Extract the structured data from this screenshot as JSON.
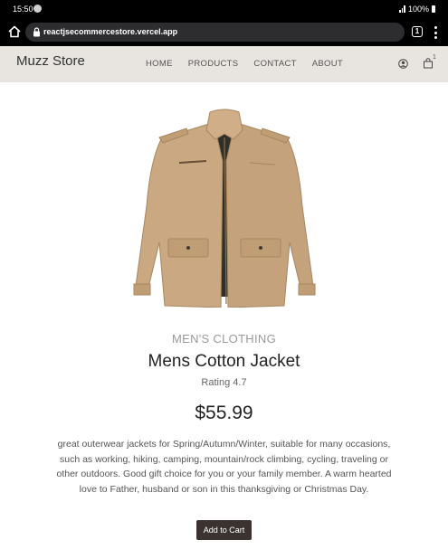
{
  "status_bar": {
    "time": "15:50",
    "battery": "100%",
    "signal_icon": "signal-icon",
    "battery_icon": "battery-icon"
  },
  "browser": {
    "url": "reactjsecommercestore.vercel.app",
    "tab_count": "1",
    "icons": [
      "home-icon",
      "lock-icon",
      "tabs-icon",
      "menu-icon"
    ]
  },
  "navbar": {
    "brand": "Muzz Store",
    "links": [
      "HOME",
      "PRODUCTS",
      "CONTACT",
      "ABOUT"
    ],
    "cart_count": "1",
    "icons": [
      "account-icon",
      "cart-icon"
    ]
  },
  "product": {
    "image_icon": "jacket-image",
    "category": "MEN'S CLOTHING",
    "title": "Mens Cotton Jacket",
    "rating": "Rating 4.7",
    "price": "$55.99",
    "description": "great outerwear jackets for Spring/Autumn/Winter, suitable for many occasions, such as working, hiking, camping, mountain/rock climbing, cycling, traveling or other outdoors. Good gift choice for you or your family member. A warm hearted love to Father, husband or son in this thanksgiving or Christmas Day.",
    "add_to_cart_label": "Add to Cart"
  },
  "colors": {
    "navbar_bg": "#e8e4df",
    "button_bg": "#3a3330",
    "jacket": "#c9a882"
  }
}
